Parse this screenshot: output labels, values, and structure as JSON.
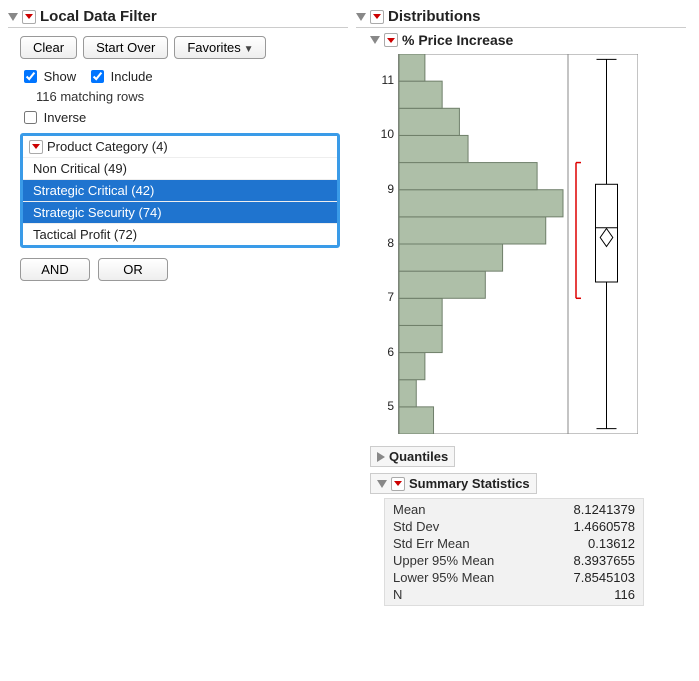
{
  "left": {
    "title": "Local Data Filter",
    "buttons": {
      "clear": "Clear",
      "start_over": "Start Over",
      "favorites": "Favorites"
    },
    "show_label": "Show",
    "include_label": "Include",
    "show_checked": true,
    "include_checked": true,
    "matching": "116 matching rows",
    "inverse_label": "Inverse",
    "inverse_checked": false,
    "list_title": "Product Category (4)",
    "items": [
      {
        "label": "Non Critical (49)",
        "selected": false
      },
      {
        "label": "Strategic Critical (42)",
        "selected": true
      },
      {
        "label": "Strategic Security (74)",
        "selected": true
      },
      {
        "label": "Tactical Profit (72)",
        "selected": false
      }
    ],
    "and": "AND",
    "or": "OR"
  },
  "right": {
    "title": "Distributions",
    "subtitle": "% Price Increase",
    "quantiles_label": "Quantiles",
    "summary_label": "Summary Statistics",
    "stats": [
      {
        "lbl": "Mean",
        "val": "8.1241379"
      },
      {
        "lbl": "Std Dev",
        "val": "1.4660578"
      },
      {
        "lbl": "Std Err Mean",
        "val": "0.13612"
      },
      {
        "lbl": "Upper 95% Mean",
        "val": "8.3937655"
      },
      {
        "lbl": "Lower 95% Mean",
        "val": "7.8545103"
      },
      {
        "lbl": "N",
        "val": "116"
      }
    ]
  },
  "chart_data": {
    "type": "bar",
    "orientation": "horizontal",
    "title": "% Price Increase",
    "ylabel": "% Price Increase",
    "ylim": [
      4.5,
      11.5
    ],
    "bins": [
      {
        "lo": 4.5,
        "hi": 5.0,
        "count": 4
      },
      {
        "lo": 5.0,
        "hi": 5.5,
        "count": 2
      },
      {
        "lo": 5.5,
        "hi": 6.0,
        "count": 3
      },
      {
        "lo": 6.0,
        "hi": 6.5,
        "count": 5
      },
      {
        "lo": 6.5,
        "hi": 7.0,
        "count": 5
      },
      {
        "lo": 7.0,
        "hi": 7.5,
        "count": 10
      },
      {
        "lo": 7.5,
        "hi": 8.0,
        "count": 12
      },
      {
        "lo": 8.0,
        "hi": 8.5,
        "count": 17
      },
      {
        "lo": 8.5,
        "hi": 9.0,
        "count": 19
      },
      {
        "lo": 9.0,
        "hi": 9.5,
        "count": 16
      },
      {
        "lo": 9.5,
        "hi": 10.0,
        "count": 8
      },
      {
        "lo": 10.0,
        "hi": 10.5,
        "count": 7
      },
      {
        "lo": 10.5,
        "hi": 11.0,
        "count": 5
      },
      {
        "lo": 11.0,
        "hi": 11.5,
        "count": 3
      }
    ],
    "axis_ticks": [
      5,
      6,
      7,
      8,
      9,
      10,
      11
    ],
    "boxplot": {
      "min": 4.6,
      "q1": 7.3,
      "median": 8.3,
      "q3": 9.1,
      "max": 11.4,
      "mean": 8.12,
      "bracket_lo": 7.0,
      "bracket_hi": 9.5
    }
  }
}
